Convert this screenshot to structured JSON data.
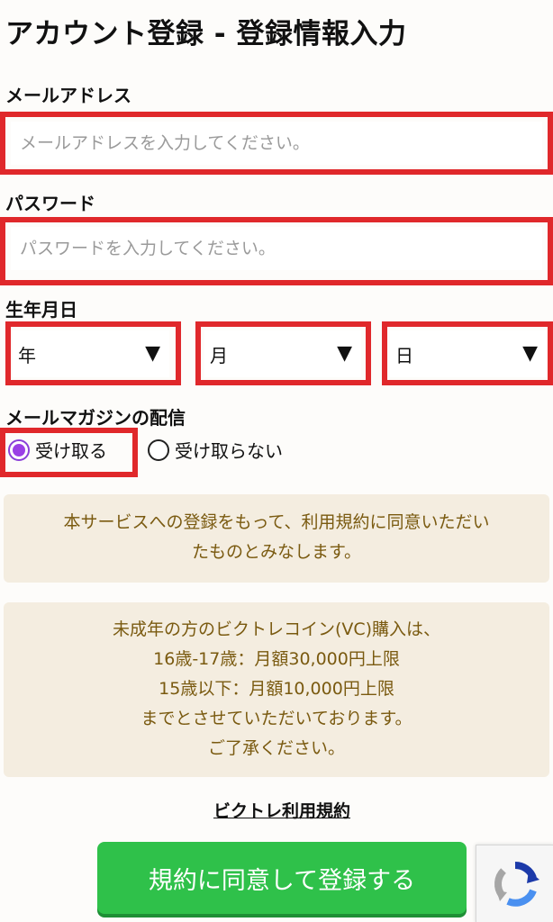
{
  "page": {
    "title": "アカウント登録 - 登録情報入力"
  },
  "form": {
    "email": {
      "label": "メールアドレス",
      "placeholder": "メールアドレスを入力してください。",
      "value": ""
    },
    "password": {
      "label": "パスワード",
      "placeholder": "パスワードを入力してください。",
      "value": ""
    },
    "birthdate": {
      "label": "生年月日",
      "year": "年",
      "month": "月",
      "day": "日"
    },
    "newsletter": {
      "label": "メールマガジンの配信",
      "options": [
        {
          "label": "受け取る",
          "selected": true
        },
        {
          "label": "受け取らない",
          "selected": false
        }
      ]
    }
  },
  "notices": {
    "agreement_lines": [
      "本サービスへの登録をもって、利用規約に同意いただい",
      "たものとみなします。"
    ],
    "minor_lines": [
      "未成年の方のビクトレコイン(VC)購入は、",
      "16歳-17歳：月額30,000円上限",
      "15歳以下：月額10,000円上限",
      "までとさせていただいております。",
      "ご了承ください。"
    ]
  },
  "terms_link": "ビクトレ利用規約",
  "submit_label": "規約に同意して登録する",
  "colors": {
    "highlight": "#e0282b",
    "accent_green": "#2fc14a",
    "notice_bg": "#f4ede0",
    "notice_text": "#7a5a10",
    "radio_selected": "#9b3fe6"
  },
  "icons": {
    "select_arrow": "triangle-down",
    "recaptcha": "recaptcha-logo"
  }
}
